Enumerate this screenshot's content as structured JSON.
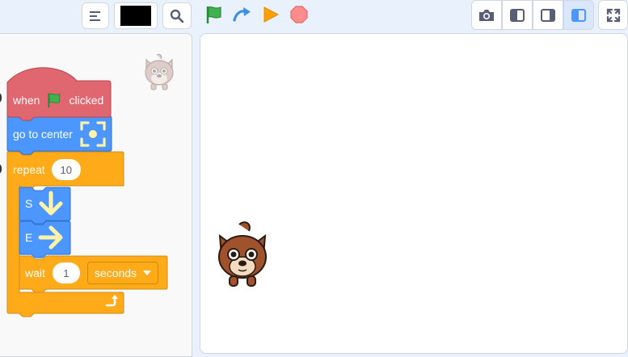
{
  "toolbar": {
    "menu_icon": "hamburger-icon",
    "pen_color": "#000000",
    "search_icon": "magnifier-icon",
    "run_controls": [
      {
        "name": "green-flag-icon",
        "color": "#3fb34f"
      },
      {
        "name": "step-arrow-icon",
        "color": "#3b8fe6"
      },
      {
        "name": "play-triangle-icon",
        "color": "#ff9f00"
      },
      {
        "name": "stop-octagon-icon",
        "color": "#ff8c8c"
      }
    ],
    "view_buttons": [
      "camera-icon",
      "layout-left-icon",
      "layout-right-icon",
      "layout-small-stage-icon"
    ],
    "fullscreen_icon": "fullscreen-icon"
  },
  "script": {
    "hat": {
      "when": "when",
      "clicked": "clicked"
    },
    "goto": {
      "label": "go to center"
    },
    "repeat": {
      "label": "repeat",
      "count": "10"
    },
    "move_s": {
      "label": "S"
    },
    "move_e": {
      "label": "E"
    },
    "wait": {
      "label": "wait",
      "value": "1",
      "unit": "seconds"
    }
  },
  "colors": {
    "events": "#e0666f",
    "motion": "#4c97ff",
    "control": "#ffab19",
    "background": "#e9f1fc",
    "stage": "#ffffff"
  }
}
